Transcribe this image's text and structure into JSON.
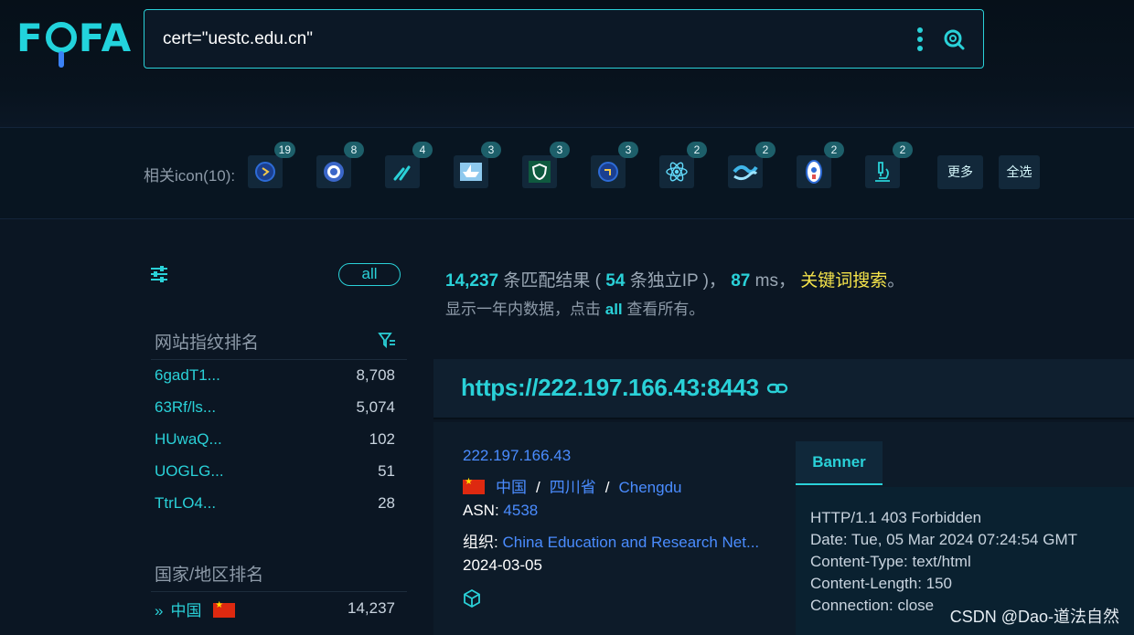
{
  "logo": {
    "text_f": "F",
    "text_fa": "FA"
  },
  "search": {
    "query": "cert=\"uestc.edu.cn\""
  },
  "icons": {
    "label": "相关icon(10):",
    "items": [
      {
        "count": "19",
        "icon": "blue-circle-logo"
      },
      {
        "count": "8",
        "icon": "university-seal"
      },
      {
        "count": "4",
        "icon": "tools-icon"
      },
      {
        "count": "3",
        "icon": "paper-boat"
      },
      {
        "count": "3",
        "icon": "green-shield"
      },
      {
        "count": "3",
        "icon": "blue-circle-logo-2"
      },
      {
        "count": "2",
        "icon": "react-icon"
      },
      {
        "count": "2",
        "icon": "swirl-icon"
      },
      {
        "count": "2",
        "icon": "crest-icon"
      },
      {
        "count": "2",
        "icon": "microscope-icon"
      }
    ],
    "more_label": "更多",
    "select_all_label": "全选"
  },
  "sidebar": {
    "all_label": "all",
    "fingerprint_heading": "网站指纹排名",
    "fingerprints": [
      {
        "name": "6gadT1...",
        "count": "8,708"
      },
      {
        "name": "63Rf/ls...",
        "count": "5,074"
      },
      {
        "name": "HUwaQ...",
        "count": "102"
      },
      {
        "name": "UOGLG...",
        "count": "51"
      },
      {
        "name": "TtrLO4...",
        "count": "28"
      }
    ],
    "country_heading": "国家/地区排名",
    "countries": [
      {
        "name": "中国",
        "count": "14,237"
      }
    ]
  },
  "summary": {
    "total": "14,237",
    "match_text": " 条匹配结果 ( ",
    "unique_ip": "54",
    "ip_text": " 条独立IP )， ",
    "ms": "87",
    "ms_text": " ms， ",
    "keyword_search": "关键词搜索",
    "end": "。",
    "sub_prefix": "显示一年内数据，点击 ",
    "sub_all": "all",
    "sub_suffix": " 查看所有。"
  },
  "result": {
    "url": "https://222.197.166.43:8443",
    "ip": "222.197.166.43",
    "country": "中国",
    "province": "四川省",
    "city": "Chengdu",
    "asn_label": "ASN:",
    "asn": "4538",
    "org_label": "组织:",
    "org": "China Education and Research Net...",
    "date": "2024-03-05",
    "banner_tab": "Banner",
    "banner_lines": [
      "HTTP/1.1 403 Forbidden",
      "Date: Tue, 05 Mar 2024 07:24:54 GMT",
      "Content-Type: text/html",
      "Content-Length: 150",
      "Connection: close"
    ]
  },
  "watermark": "CSDN @Dao-道法自然",
  "colors": {
    "accent": "#2ad1d8",
    "link": "#4a8cff",
    "keyword": "#f5e34a",
    "background": "#0b1623"
  }
}
